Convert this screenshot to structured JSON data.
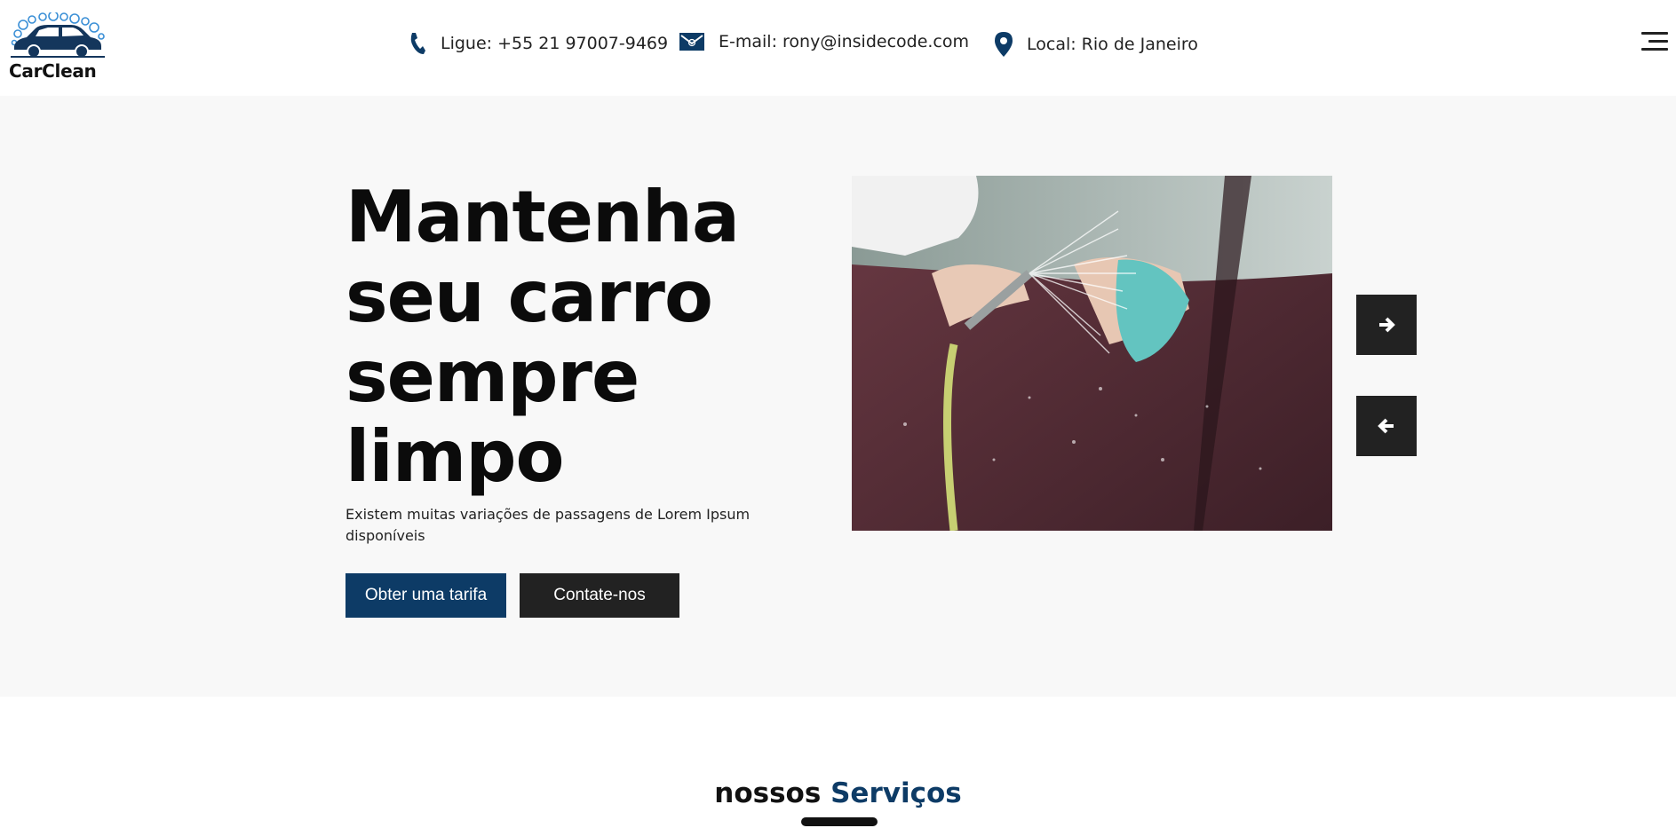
{
  "brand": {
    "name": "CarClean",
    "logo_icon": "car-wash-logo"
  },
  "header": {
    "phone": {
      "icon": "phone-icon",
      "text": "Ligue: +55 21 97007-9469"
    },
    "email": {
      "icon": "envelope-icon",
      "text": "E-mail: rony@insidecode.com"
    },
    "location": {
      "icon": "map-pin-icon",
      "text": "Local: Rio de Janeiro"
    },
    "menu_icon": "hamburger-menu-icon"
  },
  "hero": {
    "title": "Mantenha seu carro sempre limpo",
    "subtitle": "Existem muitas variações de passagens de Lorem Ipsum disponíveis",
    "primary_button": "Obter uma tarifa",
    "secondary_button": "Contate-nos",
    "next_icon": "arrow-right-icon",
    "prev_icon": "arrow-left-icon"
  },
  "services": {
    "title_prefix": "nossos",
    "title_accent": "Serviços"
  },
  "colors": {
    "brand": "#0d3b66",
    "dark": "#222222",
    "hero_bg": "#f8f8f8",
    "logo_bubbles": "#3a8fd6"
  }
}
